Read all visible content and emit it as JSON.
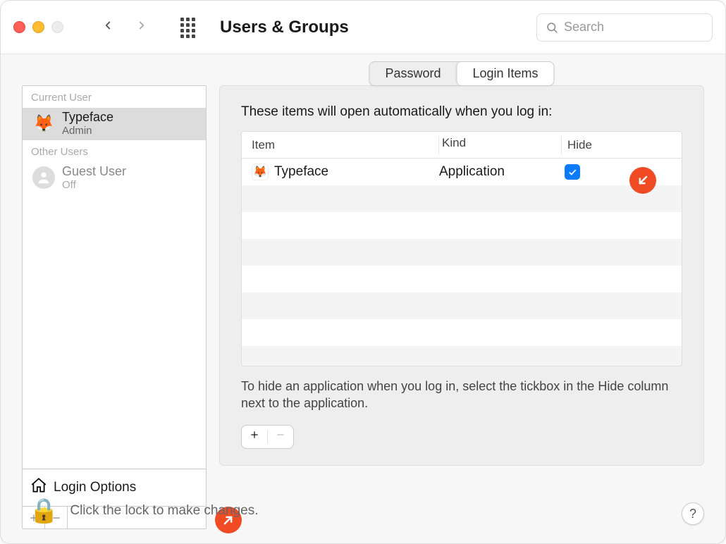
{
  "toolbar": {
    "title": "Users & Groups",
    "search_placeholder": "Search"
  },
  "sidebar": {
    "current_header": "Current User",
    "other_header": "Other Users",
    "current_user": {
      "name": "Typeface",
      "role": "Admin",
      "icon": "🦊"
    },
    "other_users": [
      {
        "name": "Guest User",
        "role": "Off"
      }
    ],
    "login_options_label": "Login Options"
  },
  "tabs": {
    "password": "Password",
    "login_items": "Login Items"
  },
  "main": {
    "lead": "These items will open automatically when you log in:",
    "columns": {
      "item": "Item",
      "kind": "Kind",
      "hide": "Hide"
    },
    "rows": [
      {
        "icon": "🦊",
        "name": "Typeface",
        "kind": "Application",
        "hide": true
      }
    ],
    "hint": "To hide an application when you log in, select the tickbox in the Hide column next to the application."
  },
  "footer": {
    "lock_text": "Click the lock to make changes.",
    "help": "?"
  }
}
